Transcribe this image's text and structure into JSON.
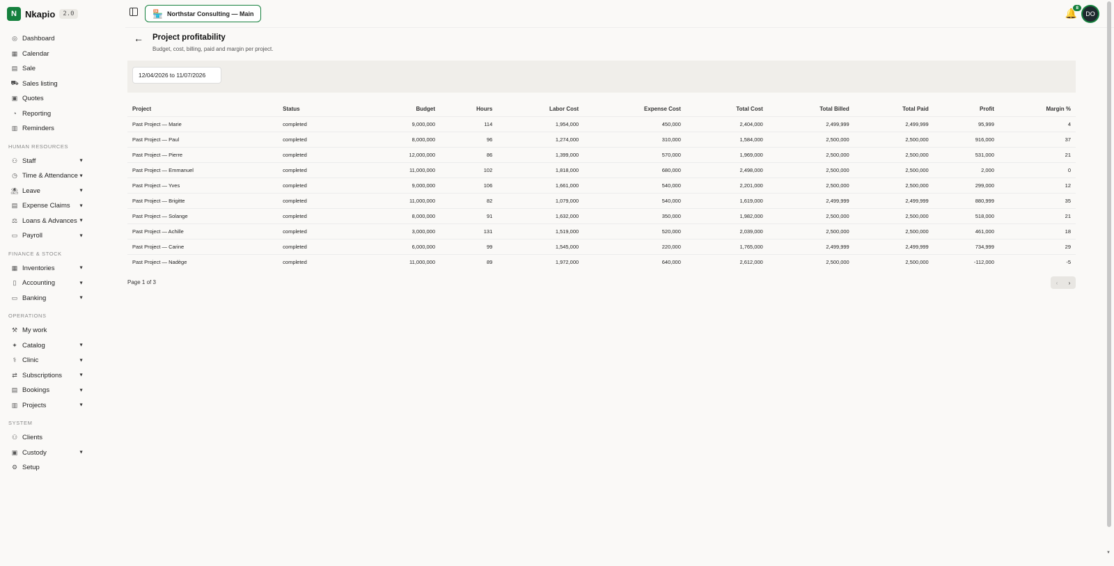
{
  "app": {
    "name": "Nkapio",
    "version": "2.0",
    "logo_letter": "N",
    "accent_color": "#15803d"
  },
  "topbar": {
    "org_name": "Northstar Consulting — Main",
    "notifications_count": "8",
    "avatar_initials": "DO"
  },
  "sidebar": {
    "top_items": [
      {
        "label": "Dashboard",
        "icon": "dashboard-icon"
      },
      {
        "label": "Calendar",
        "icon": "calendar-icon"
      },
      {
        "label": "Sale",
        "icon": "sale-icon"
      },
      {
        "label": "Sales listing",
        "icon": "cart-icon"
      },
      {
        "label": "Quotes",
        "icon": "quotes-icon"
      },
      {
        "label": "Reporting",
        "icon": "reporting-icon"
      },
      {
        "label": "Reminders",
        "icon": "reminders-icon"
      }
    ],
    "sections": [
      {
        "title": "Human Resources",
        "items": [
          {
            "label": "Staff",
            "icon": "staff-icon"
          },
          {
            "label": "Time & Attendance",
            "icon": "clock-icon"
          },
          {
            "label": "Leave",
            "icon": "leave-icon"
          },
          {
            "label": "Expense Claims",
            "icon": "expense-icon"
          },
          {
            "label": "Loans & Advances",
            "icon": "loans-icon"
          },
          {
            "label": "Payroll",
            "icon": "payroll-icon"
          }
        ]
      },
      {
        "title": "Finance & Stock",
        "items": [
          {
            "label": "Inventories",
            "icon": "inventories-icon"
          },
          {
            "label": "Accounting",
            "icon": "book-icon"
          },
          {
            "label": "Banking",
            "icon": "banking-icon"
          }
        ]
      },
      {
        "title": "Operations",
        "items": [
          {
            "label": "My work",
            "icon": "wrench-icon"
          },
          {
            "label": "Catalog",
            "icon": "catalog-icon"
          },
          {
            "label": "Clinic",
            "icon": "stethoscope-icon"
          },
          {
            "label": "Subscriptions",
            "icon": "repeat-icon"
          },
          {
            "label": "Bookings",
            "icon": "bookings-icon"
          },
          {
            "label": "Projects",
            "icon": "projects-icon"
          }
        ]
      },
      {
        "title": "System",
        "items": [
          {
            "label": "Clients",
            "icon": "user-icon"
          },
          {
            "label": "Custody",
            "icon": "box-icon"
          },
          {
            "label": "Setup",
            "icon": "gear-icon"
          }
        ]
      }
    ]
  },
  "page": {
    "title": "Project profitability",
    "subtitle": "Budget, cost, billing, paid and margin per project.",
    "date_range": "12/04/2026 to 11/07/2026"
  },
  "table": {
    "columns": [
      "Project",
      "Status",
      "Budget",
      "Hours",
      "Labor Cost",
      "Expense Cost",
      "Total Cost",
      "Total Billed",
      "Total Paid",
      "Profit",
      "Margin %"
    ],
    "rows": [
      [
        "Past Project — Marie",
        "completed",
        "9,000,000",
        "114",
        "1,954,000",
        "450,000",
        "2,404,000",
        "2,499,999",
        "2,499,999",
        "95,999",
        "4"
      ],
      [
        "Past Project — Paul",
        "completed",
        "8,000,000",
        "96",
        "1,274,000",
        "310,000",
        "1,584,000",
        "2,500,000",
        "2,500,000",
        "916,000",
        "37"
      ],
      [
        "Past Project — Pierre",
        "completed",
        "12,000,000",
        "86",
        "1,399,000",
        "570,000",
        "1,969,000",
        "2,500,000",
        "2,500,000",
        "531,000",
        "21"
      ],
      [
        "Past Project — Emmanuel",
        "completed",
        "11,000,000",
        "102",
        "1,818,000",
        "680,000",
        "2,498,000",
        "2,500,000",
        "2,500,000",
        "2,000",
        "0"
      ],
      [
        "Past Project — Yves",
        "completed",
        "9,000,000",
        "106",
        "1,661,000",
        "540,000",
        "2,201,000",
        "2,500,000",
        "2,500,000",
        "299,000",
        "12"
      ],
      [
        "Past Project — Brigitte",
        "completed",
        "11,000,000",
        "82",
        "1,079,000",
        "540,000",
        "1,619,000",
        "2,499,999",
        "2,499,999",
        "880,999",
        "35"
      ],
      [
        "Past Project — Solange",
        "completed",
        "8,000,000",
        "91",
        "1,632,000",
        "350,000",
        "1,982,000",
        "2,500,000",
        "2,500,000",
        "518,000",
        "21"
      ],
      [
        "Past Project — Achille",
        "completed",
        "3,000,000",
        "131",
        "1,519,000",
        "520,000",
        "2,039,000",
        "2,500,000",
        "2,500,000",
        "461,000",
        "18"
      ],
      [
        "Past Project — Carine",
        "completed",
        "6,000,000",
        "99",
        "1,545,000",
        "220,000",
        "1,765,000",
        "2,499,999",
        "2,499,999",
        "734,999",
        "29"
      ],
      [
        "Past Project — Nadège",
        "completed",
        "11,000,000",
        "89",
        "1,972,000",
        "640,000",
        "2,612,000",
        "2,500,000",
        "2,500,000",
        "-112,000",
        "-5"
      ]
    ]
  },
  "pagination": {
    "info": "Page 1 of 3",
    "prev": "‹",
    "next": "›"
  }
}
